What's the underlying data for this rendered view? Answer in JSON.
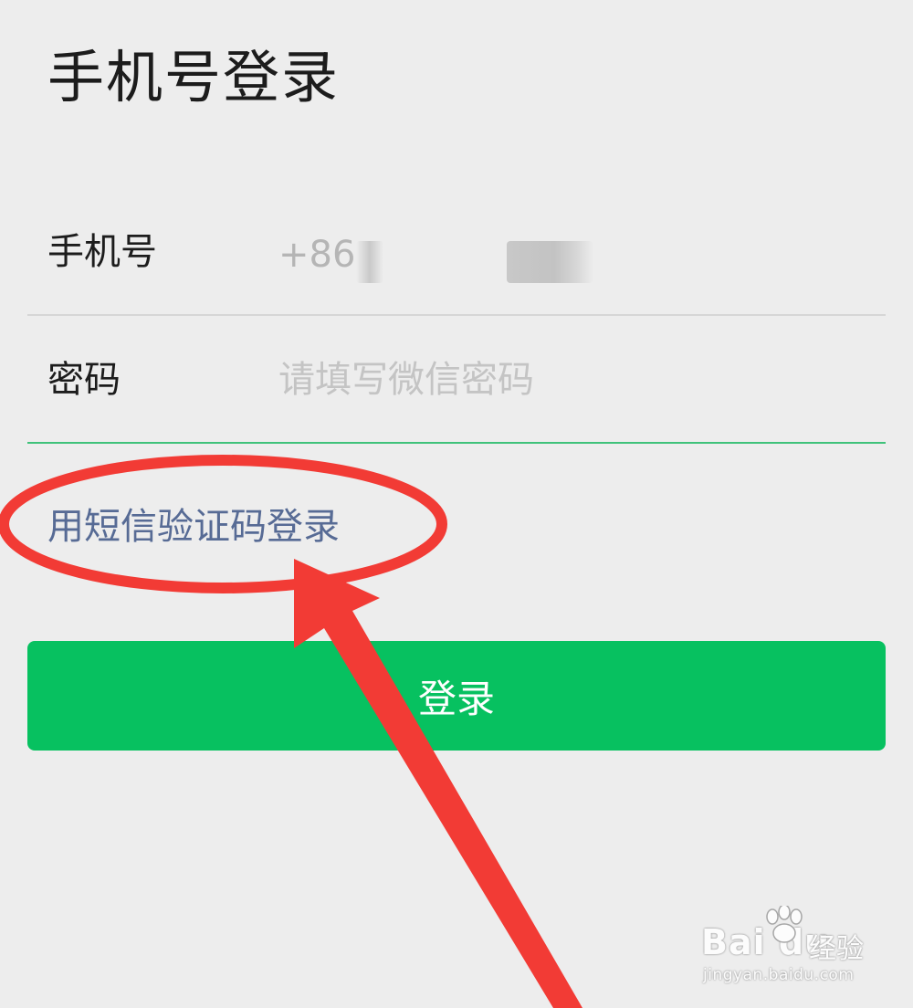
{
  "page": {
    "title": "手机号登录"
  },
  "form": {
    "phone": {
      "label": "手机号",
      "prefix": "+86"
    },
    "password": {
      "label": "密码",
      "placeholder": "请填写微信密码"
    }
  },
  "links": {
    "sms_login": "用短信验证码登录"
  },
  "actions": {
    "login_label": "登录"
  },
  "colors": {
    "background": "#ededed",
    "primary_green": "#07c160",
    "link_blue": "#576b95",
    "annotation_red": "#f23b35"
  },
  "watermark": {
    "brand": "Bai du",
    "product": "经验",
    "url": "jingyan.baidu.com"
  }
}
